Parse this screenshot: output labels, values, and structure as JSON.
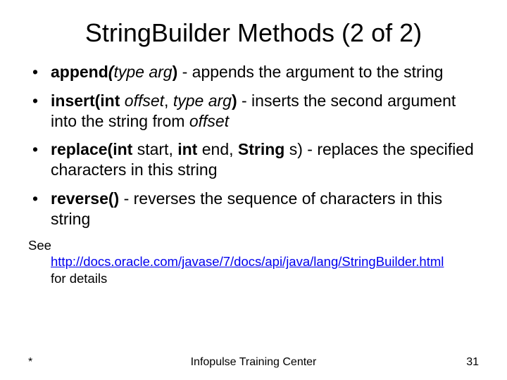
{
  "title": "StringBuilder Methods (2 of 2)",
  "bullets": [
    {
      "sig_b1": "append",
      "sig_bi1": "(",
      "sig_i1": "type arg",
      "sig_b2": ")",
      "desc": " - appends the argument to the string"
    },
    {
      "sig_b1": "insert(int ",
      "sig_i1": "offset",
      "sig_p1": ", ",
      "sig_i2": "type arg",
      "sig_b2": ")",
      "desc1": " - inserts the second argument into the string from ",
      "desc_i": "offset"
    },
    {
      "sig_b1": "replace(int ",
      "sig_p1": "start, ",
      "sig_b2": "int ",
      "sig_p2": "end, ",
      "sig_b3": "String ",
      "sig_p3": "s)",
      "desc": " - replaces the specified characters in this string"
    },
    {
      "sig_b1": "reverse()",
      "desc": " - reverses the sequence of characters in this string"
    }
  ],
  "note_pre": "See",
  "note_link": "http://docs.oracle.com/javase/7/docs/api/java/lang/StringBuilder.html",
  "note_post": "for details",
  "footer_left": "*",
  "footer_center": "Infopulse Training Center",
  "footer_right": "31"
}
